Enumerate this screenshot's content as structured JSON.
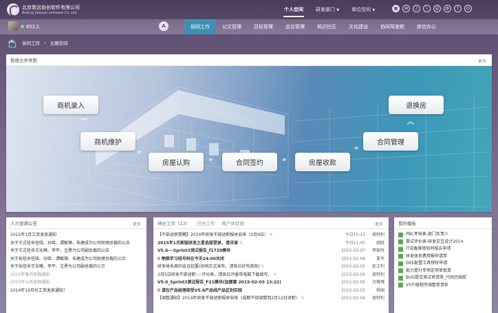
{
  "brand": {
    "name_cn": "北京致远协创软件有限公司",
    "name_en": "Beijing Seeyon software Co.,Ltd."
  },
  "top_nav": [
    {
      "label": "个人空间",
      "active": true
    },
    {
      "label": "研发部门",
      "active": false
    },
    {
      "label": "单位空间",
      "active": false
    }
  ],
  "top_tools": [
    "grid-icon",
    "chat-icon",
    "bell-icon",
    "info-icon",
    "user-icon",
    "settings-icon",
    "help-icon",
    "power-icon"
  ],
  "user": {
    "online_count": "852人"
  },
  "home_button": "A",
  "main_menu": [
    {
      "label": "协同工作",
      "active": true
    },
    {
      "label": "公文管理",
      "active": false
    },
    {
      "label": "目标管理",
      "active": false
    },
    {
      "label": "会议管理",
      "active": false
    },
    {
      "label": "知识社区",
      "active": false
    },
    {
      "label": "文化建设",
      "active": false
    },
    {
      "label": "协同驾驶舱",
      "active": false
    },
    {
      "label": "综合办公",
      "active": false
    }
  ],
  "breadcrumb": [
    "协同工作",
    "主题空间"
  ],
  "flow_panel": {
    "title": "售楼业务导图",
    "more": "更多",
    "nodes": [
      "商机录入",
      "商机维护",
      "房屋认购",
      "合同签约",
      "房屋收款",
      "合同管理",
      "退换房"
    ]
  },
  "hr_panel": {
    "title": "人力资源公告",
    "more": "更多",
    "items": [
      {
        "text": "2015年1月工资发放通知",
        "faded": false
      },
      {
        "text": "关于王式任命任晓、孙臣、谭敏锋、朱建成为公司助理总裁的公告",
        "faded": false
      },
      {
        "text": "关于王式任命王化曦、李平、注勇为公司副总裁的公告",
        "faded": false
      },
      {
        "text": "关于拟任命任晓、孙臣、谭敏锋、朱建成为公司助理总裁的公示",
        "faded": false
      },
      {
        "text": "关于拟任命王化曦、李平、注勇为公司副总裁的公示",
        "faded": false
      },
      {
        "text": "2015年春节放假通知",
        "faded": true
      },
      {
        "text": "2015年元旦放假通知",
        "faded": true
      },
      {
        "text": "2014年10月份工资发放通知！",
        "faded": false
      }
    ]
  },
  "work_panel": {
    "tabs": [
      {
        "label": "待办工作（23）",
        "active": true
      },
      {
        "label": "已办工作",
        "active": false
      },
      {
        "label": "用户体验部",
        "active": false
      }
    ],
    "more": "更多",
    "items": [
      {
        "text": "【干部述职提醒】2014年研发干部述职报体安排（2月9日）",
        "date": "今日10:13",
        "who": "周特利",
        "bold": false,
        "flag": false,
        "clip": true
      },
      {
        "text": "2015年1月新版研发之星选拔登录，请详读",
        "date": "今日11:05",
        "who": "胡晓",
        "bold": true,
        "flag": false,
        "clip": true
      },
      {
        "text": "V5.6---Sprint3测试报告_f1739模块",
        "date": "2015-02-07",
        "who": "李家时",
        "bold": true,
        "flag": false,
        "clip": false
      },
      {
        "text": "晒佛学习班号码在今天24:00关闭",
        "date": "2015-02-06",
        "who": "夏冬",
        "bold": true,
        "flag": true,
        "clip": false
      },
      {
        "text": "研发体系周的会议纪要(协同正式发布，请各位好先修改)",
        "date": "2015-02-05",
        "who": "彭江利",
        "bold": false,
        "flag": false,
        "clip": true
      },
      {
        "text": "2月5日研发干部述职----评分表，请各位评委带电脑下载填写。",
        "date": "2015-02-05",
        "who": "周特利",
        "bold": false,
        "flag": false,
        "clip": true
      },
      {
        "text": "V5.6_Sprint3测试报告_F21模块(加挪挪 2015-02-03 13:22)",
        "date": "2015-02-05",
        "who": "刘博博",
        "bold": true,
        "flag": false,
        "clip": false
      },
      {
        "text": "请在产品经理接受V5.6产品线产品区别实践",
        "date": "2015-02-03",
        "who": "杨国",
        "bold": true,
        "flag": true,
        "clip": false
      },
      {
        "text": "【调整通知】2014年研发干部述职报体安排（成都干部调整到2月12日述职）",
        "date": "2015-02-04",
        "who": "周特利",
        "bold": false,
        "flag": false,
        "clip": true
      }
    ]
  },
  "modules_panel": {
    "title": "我的模板",
    "items": [
      "PBC考核表-部门负责人",
      "需试评价表-研发交互设计2014",
      "IT设备维修协同报告申请",
      "研发体系费用报申请单",
      "DEE配置工具授权申请",
      "能力提升专项定项审批单",
      "BUG提交测试审请单_代码历结航",
      "V5升级程序调整单请系"
    ]
  },
  "colors": {
    "header": "#4a3c5c",
    "active_menu": "#3f8fb0",
    "accent_teal": "#7fd0d0"
  }
}
